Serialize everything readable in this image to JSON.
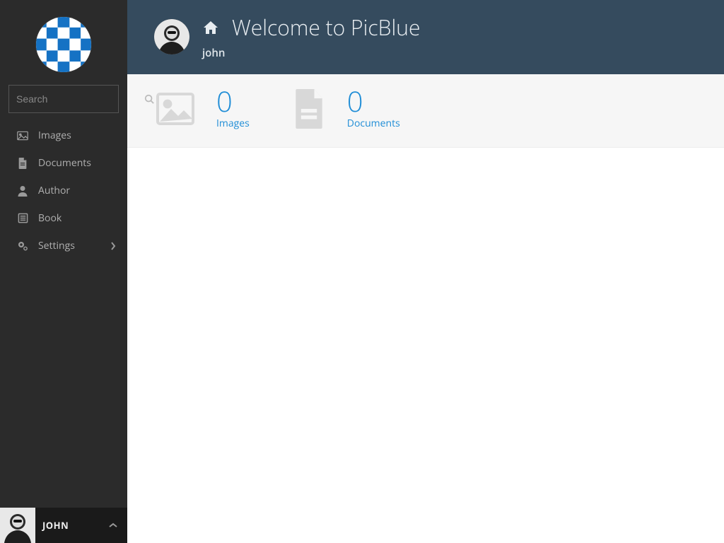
{
  "app": {
    "name": "PicBlue"
  },
  "search": {
    "placeholder": "Search"
  },
  "sidebar": {
    "items": [
      {
        "label": "Images",
        "icon": "image-icon"
      },
      {
        "label": "Documents",
        "icon": "document-icon"
      },
      {
        "label": "Author",
        "icon": "user-icon"
      },
      {
        "label": "Book",
        "icon": "book-icon"
      },
      {
        "label": "Settings",
        "icon": "gears-icon",
        "hasChildren": true
      }
    ]
  },
  "user": {
    "name": "john",
    "display_upper": "JOHN"
  },
  "header": {
    "title": "Welcome to PicBlue"
  },
  "stats": [
    {
      "count": "0",
      "label": "Images",
      "icon": "image-icon"
    },
    {
      "count": "0",
      "label": "Documents",
      "icon": "document-icon"
    }
  ],
  "colors": {
    "accent": "#1f8dd6",
    "header": "#354b5e",
    "sidebar": "#2b2b2b"
  }
}
